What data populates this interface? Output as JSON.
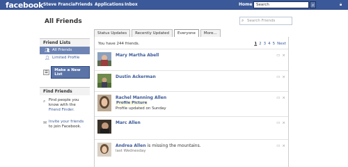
{
  "topbar": {
    "logo": "facebook",
    "nav": [
      "Steve Francia",
      "Friends",
      "Applications",
      "Inbox"
    ],
    "home": "Home",
    "search_placeholder": "Search"
  },
  "page": {
    "title": "All Friends",
    "friend_search_placeholder": "Search Friends"
  },
  "tabs": [
    "Status Updates",
    "Recently Updated",
    "Everyone",
    "More..."
  ],
  "active_tab": "Everyone",
  "sidebar": {
    "lists_header": "Friend Lists",
    "items": [
      "All Friends",
      "Limited Profile"
    ],
    "new_list_button": "Make a New List",
    "find_header": "Find Friends",
    "find_text_1": "Find people you know with the",
    "find_link_1": "Friend Finder.",
    "find_link_2": "Invite your friends",
    "find_text_2": "to join Facebook."
  },
  "main": {
    "count_text": "You have 244 friends.",
    "pages": [
      "1",
      "2",
      "3",
      "4",
      "5"
    ],
    "next": "Next",
    "friends": [
      {
        "name": "Mary Martha Abell",
        "status": "",
        "line1": "",
        "line2": ""
      },
      {
        "name": "Dustin Ackerman",
        "status": "",
        "line1": "",
        "line2": ""
      },
      {
        "name": "Rachel Manning Allen",
        "status": "",
        "line1": "Profile Picture",
        "line2": "Profile updated on Sunday"
      },
      {
        "name": "Marc Allen",
        "status": "",
        "line1": "",
        "line2": ""
      },
      {
        "name": "Andrea Allen",
        "status": "is missing the mountains.",
        "line1": "last Wednesday",
        "line2": ""
      }
    ]
  },
  "colors": {
    "brand": "#3b5998",
    "link": "#3b5998",
    "highlight": "#fff9d7"
  }
}
